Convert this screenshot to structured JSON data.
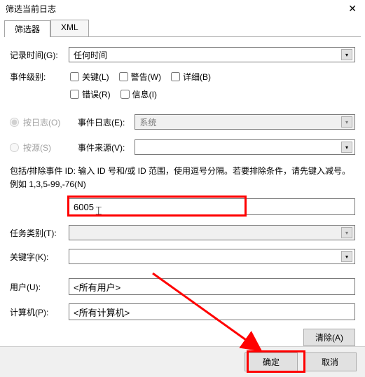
{
  "titlebar": {
    "title": "筛选当前日志"
  },
  "tabs": {
    "filter": "筛选器",
    "xml": "XML"
  },
  "labels": {
    "logged": "记录时间(G):",
    "level": "事件级别:",
    "eventLog": "事件日志(E):",
    "eventSource": "事件来源(V):",
    "taskCategory": "任务类别(T):",
    "keywords": "关键字(K):",
    "user": "用户(U):",
    "computer": "计算机(P):"
  },
  "logged_value": "任何时间",
  "level": {
    "critical": "关键(L)",
    "warning": "警告(W)",
    "verbose": "详细(B)",
    "error": "错误(R)",
    "info": "信息(I)"
  },
  "radios": {
    "byLog": "按日志(O)",
    "bySource": "按源(S)"
  },
  "eventLog_value": "系统",
  "help_text": "包括/排除事件 ID: 输入 ID 号和/或 ID 范围，使用逗号分隔。若要排除条件，请先键入减号。例如 1,3,5-99,-76(N)",
  "event_id_value": "6005",
  "user_value": "<所有用户>",
  "computer_value": "<所有计算机>",
  "buttons": {
    "clear": "清除(A)",
    "ok": "确定",
    "cancel": "取消"
  }
}
